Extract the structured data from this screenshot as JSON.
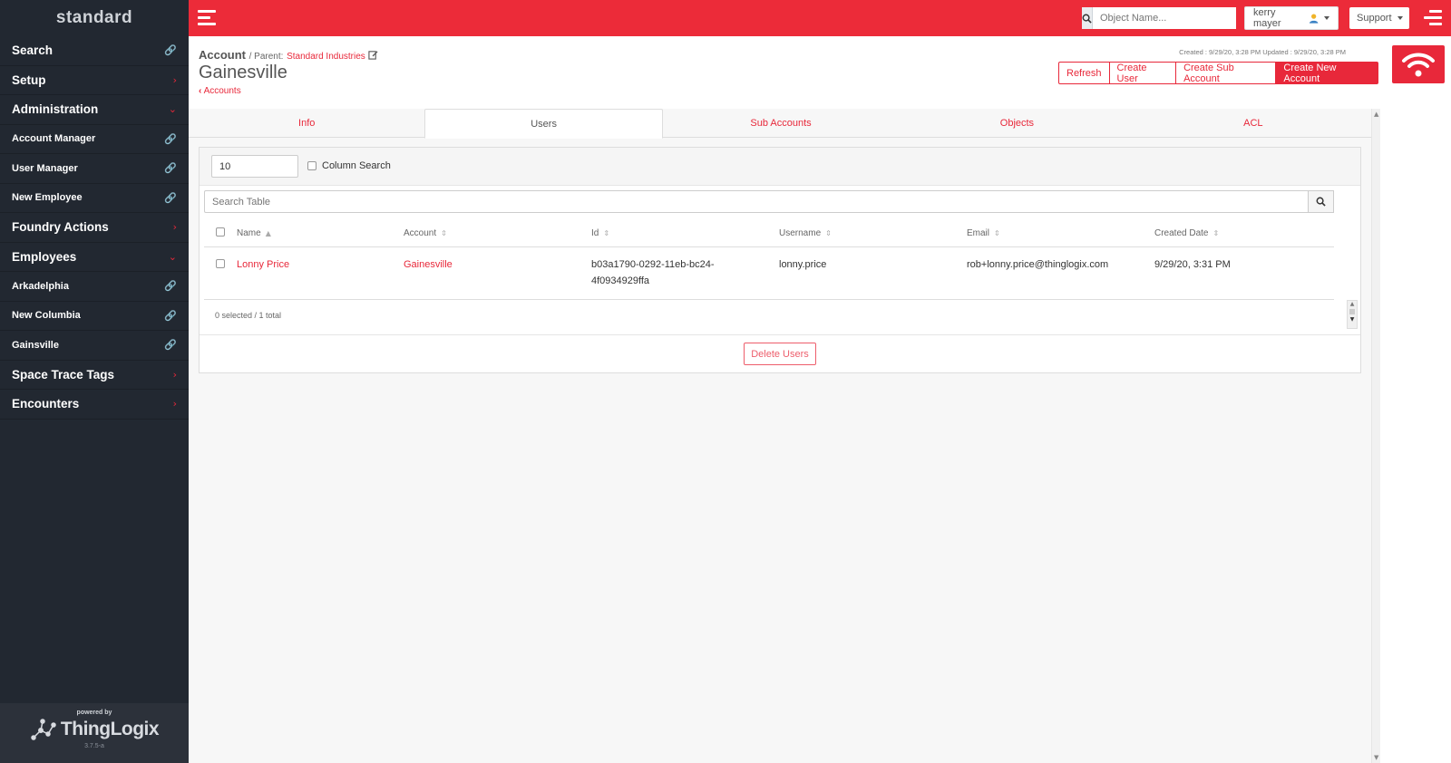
{
  "sidebar": {
    "logo": "standard",
    "items": [
      {
        "label": "Search",
        "icon": "link-icon",
        "type": "top"
      },
      {
        "label": "Setup",
        "icon": "chevron-right-icon",
        "type": "top"
      },
      {
        "label": "Administration",
        "icon": "chevron-down-icon",
        "type": "top"
      },
      {
        "label": "Account Manager",
        "icon": "link-icon",
        "type": "sub"
      },
      {
        "label": "User Manager",
        "icon": "link-icon",
        "type": "sub"
      },
      {
        "label": "New Employee",
        "icon": "link-icon",
        "type": "sub"
      },
      {
        "label": "Foundry Actions",
        "icon": "chevron-right-icon",
        "type": "top"
      },
      {
        "label": "Employees",
        "icon": "chevron-down-icon",
        "type": "top"
      },
      {
        "label": "Arkadelphia",
        "icon": "link-icon",
        "type": "sub"
      },
      {
        "label": "New Columbia",
        "icon": "link-icon",
        "type": "sub"
      },
      {
        "label": "Gainsville",
        "icon": "link-icon",
        "type": "sub"
      },
      {
        "label": "Space Trace Tags",
        "icon": "chevron-right-icon",
        "type": "top"
      },
      {
        "label": "Encounters",
        "icon": "chevron-right-icon",
        "type": "top"
      }
    ],
    "footer": {
      "powered_by": "powered by",
      "brand": "ThingLogix",
      "version": "3.7.5-a"
    }
  },
  "topbar": {
    "search_placeholder": "Object Name...",
    "user": "kerry mayer",
    "support": "Support"
  },
  "header": {
    "entity": "Account",
    "parent_label": "/ Parent:",
    "parent_link": "Standard Industries",
    "title": "Gainesville",
    "back_link": "Accounts",
    "meta": "Created : 9/29/20, 3:28 PM   Updated : 9/29/20, 3:28 PM",
    "buttons": {
      "refresh": "Refresh",
      "create_user": "Create User",
      "create_sub_account": "Create Sub Account",
      "create_new_account": "Create New Account"
    }
  },
  "tabs": [
    {
      "label": "Info",
      "active": false
    },
    {
      "label": "Users",
      "active": true
    },
    {
      "label": "Sub Accounts",
      "active": false
    },
    {
      "label": "Objects",
      "active": false
    },
    {
      "label": "ACL",
      "active": false
    }
  ],
  "table_controls": {
    "page_size": "10",
    "column_search_label": "Column Search",
    "search_placeholder": "Search Table"
  },
  "table": {
    "columns": [
      "Name",
      "Account",
      "Id",
      "Username",
      "Email",
      "Created Date"
    ],
    "rows": [
      {
        "name": "Lonny Price",
        "account": "Gainesville",
        "id_line1": "b03a1790-0292-11eb-bc24-",
        "id_line2": "4f0934929ffa",
        "username": "lonny.price",
        "email": "rob+lonny.price@thinglogix.com",
        "created": "9/29/20, 3:31 PM"
      }
    ],
    "footer_info": "0 selected / 1 total"
  },
  "actions": {
    "delete_users": "Delete Users"
  },
  "colors": {
    "accent": "#ec2b39",
    "sidebar_bg": "#222831"
  }
}
